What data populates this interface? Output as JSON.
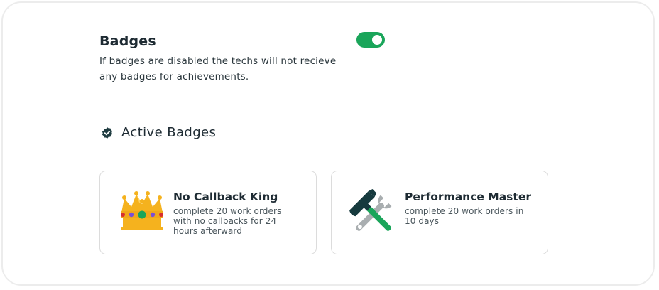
{
  "badges_setting": {
    "title": "Badges",
    "description": "If badges are disabled the techs will not recieve any badges for achievements.",
    "enabled": true,
    "accent_color": "#1aa55a"
  },
  "active_badges": {
    "heading": "Active Badges",
    "icon": "verified-check-icon",
    "items": [
      {
        "name": "No Callback King",
        "description": "complete 20 work orders with no callbacks for 24 hours afterward",
        "icon": "crown-icon"
      },
      {
        "name": "Performance Master",
        "description": "complete 20 work orders in 10 days",
        "icon": "hammer-wrench-icon"
      }
    ]
  }
}
